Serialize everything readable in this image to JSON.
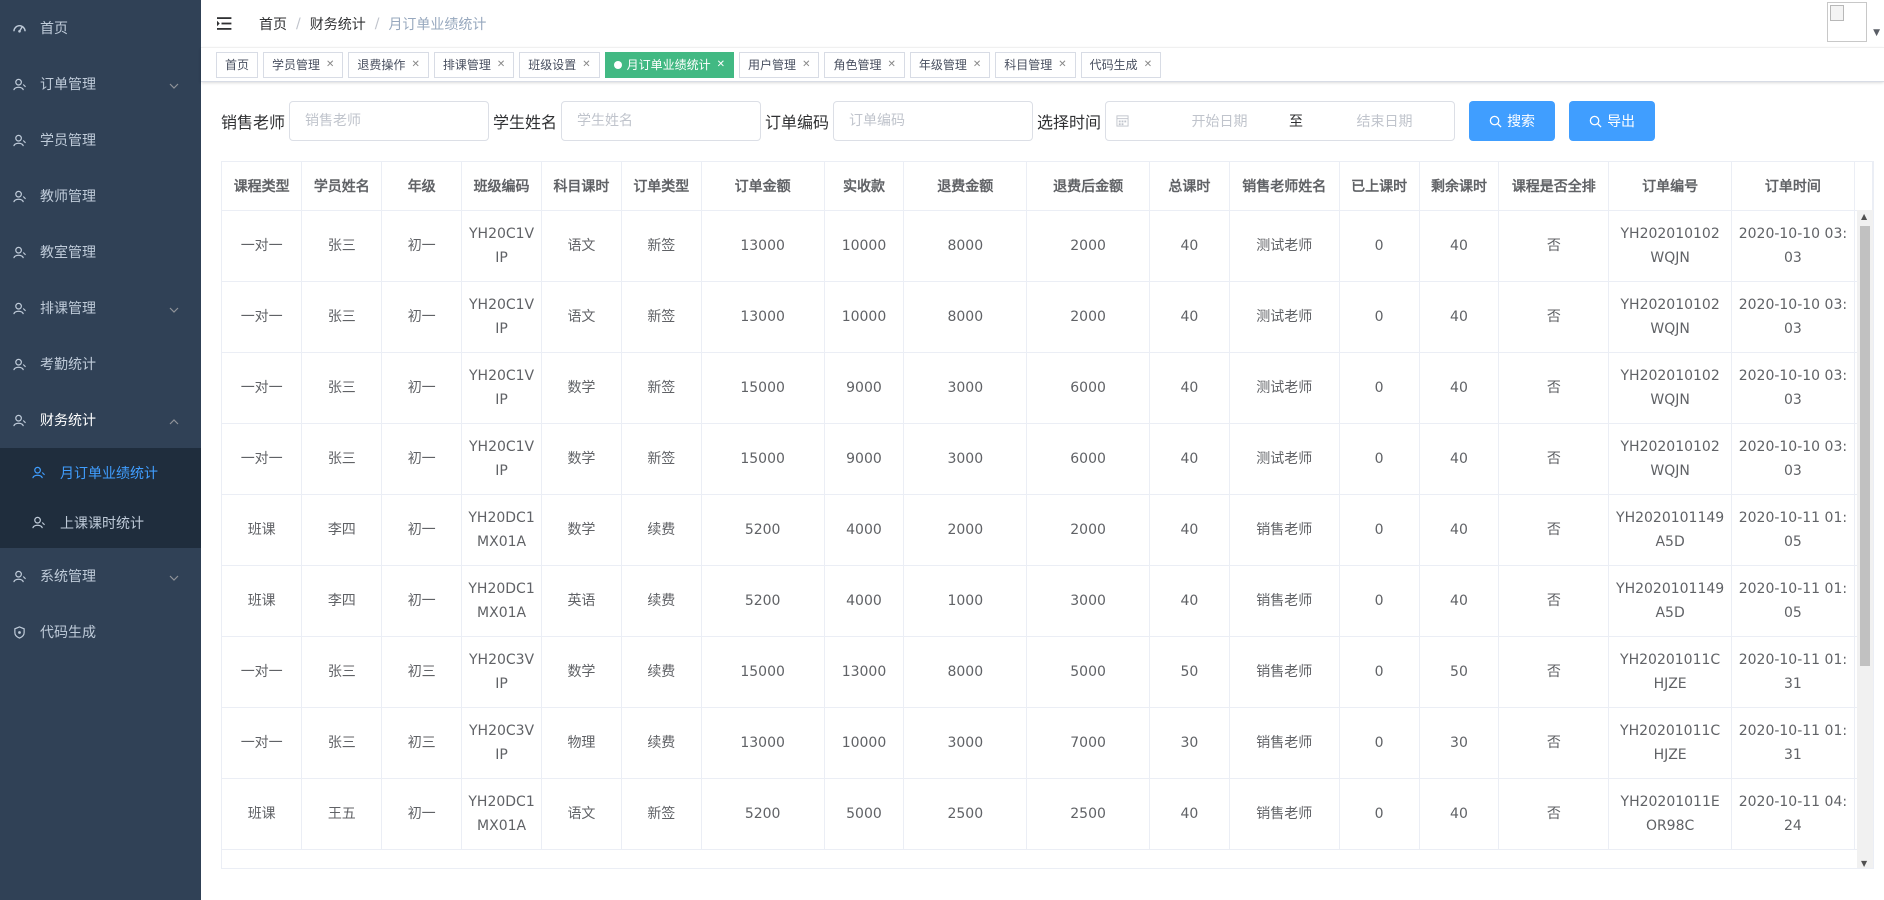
{
  "sidebar": {
    "items": [
      {
        "label": "首页",
        "icon": "dashboard-icon",
        "has_arrow": false
      },
      {
        "label": "订单管理",
        "icon": "user-icon",
        "has_arrow": true
      },
      {
        "label": "学员管理",
        "icon": "user-icon",
        "has_arrow": false
      },
      {
        "label": "教师管理",
        "icon": "user-icon",
        "has_arrow": false
      },
      {
        "label": "教室管理",
        "icon": "user-icon",
        "has_arrow": false
      },
      {
        "label": "排课管理",
        "icon": "user-icon",
        "has_arrow": true
      },
      {
        "label": "考勤统计",
        "icon": "user-icon",
        "has_arrow": false
      },
      {
        "label": "财务统计",
        "icon": "user-icon",
        "has_arrow": true,
        "open": true
      },
      {
        "label": "系统管理",
        "icon": "user-icon",
        "has_arrow": true
      },
      {
        "label": "代码生成",
        "icon": "shield-icon",
        "has_arrow": false
      }
    ],
    "finance_sub": [
      {
        "label": "月订单业绩统计",
        "active": true
      },
      {
        "label": "上课课时统计",
        "active": false
      }
    ]
  },
  "breadcrumb": [
    "首页",
    "财务统计",
    "月订单业绩统计"
  ],
  "tags": [
    {
      "label": "首页",
      "closable": false,
      "active": false
    },
    {
      "label": "学员管理",
      "closable": true,
      "active": false
    },
    {
      "label": "退费操作",
      "closable": true,
      "active": false
    },
    {
      "label": "排课管理",
      "closable": true,
      "active": false
    },
    {
      "label": "班级设置",
      "closable": true,
      "active": false
    },
    {
      "label": "月订单业绩统计",
      "closable": true,
      "active": true
    },
    {
      "label": "用户管理",
      "closable": true,
      "active": false
    },
    {
      "label": "角色管理",
      "closable": true,
      "active": false
    },
    {
      "label": "年级管理",
      "closable": true,
      "active": false
    },
    {
      "label": "科目管理",
      "closable": true,
      "active": false
    },
    {
      "label": "代码生成",
      "closable": true,
      "active": false
    }
  ],
  "search": {
    "sales_label": "销售老师",
    "sales_placeholder": "销售老师",
    "student_label": "学生姓名",
    "student_placeholder": "学生姓名",
    "order_label": "订单编码",
    "order_placeholder": "订单编码",
    "time_label": "选择时间",
    "start_placeholder": "开始日期",
    "range_sep": "至",
    "end_placeholder": "结束日期",
    "search_btn": "搜索",
    "export_btn": "导出"
  },
  "table": {
    "columns": [
      "课程类型",
      "学员姓名",
      "年级",
      "班级编码",
      "科目课时",
      "订单类型",
      "订单金额",
      "实收款",
      "退费金额",
      "退费后金额",
      "总课时",
      "销售老师姓名",
      "已上课时",
      "剩余课时",
      "课程是否全排",
      "订单编号",
      "订单时间"
    ],
    "rows": [
      [
        "一对一",
        "张三",
        "初一",
        "YH20C1VIP",
        "语文",
        "新签",
        "13000",
        "10000",
        "8000",
        "2000",
        "40",
        "测试老师",
        "0",
        "40",
        "否",
        "YH202010102WQJN",
        "2020-10-10 03:03"
      ],
      [
        "一对一",
        "张三",
        "初一",
        "YH20C1VIP",
        "语文",
        "新签",
        "13000",
        "10000",
        "8000",
        "2000",
        "40",
        "测试老师",
        "0",
        "40",
        "否",
        "YH202010102WQJN",
        "2020-10-10 03:03"
      ],
      [
        "一对一",
        "张三",
        "初一",
        "YH20C1VIP",
        "数学",
        "新签",
        "15000",
        "9000",
        "3000",
        "6000",
        "40",
        "测试老师",
        "0",
        "40",
        "否",
        "YH202010102WQJN",
        "2020-10-10 03:03"
      ],
      [
        "一对一",
        "张三",
        "初一",
        "YH20C1VIP",
        "数学",
        "新签",
        "15000",
        "9000",
        "3000",
        "6000",
        "40",
        "测试老师",
        "0",
        "40",
        "否",
        "YH202010102WQJN",
        "2020-10-10 03:03"
      ],
      [
        "班课",
        "李四",
        "初一",
        "YH20DC1MX01A",
        "数学",
        "续费",
        "5200",
        "4000",
        "2000",
        "2000",
        "40",
        "销售老师",
        "0",
        "40",
        "否",
        "YH2020101149A5D",
        "2020-10-11 01:05"
      ],
      [
        "班课",
        "李四",
        "初一",
        "YH20DC1MX01A",
        "英语",
        "续费",
        "5200",
        "4000",
        "1000",
        "3000",
        "40",
        "销售老师",
        "0",
        "40",
        "否",
        "YH2020101149A5D",
        "2020-10-11 01:05"
      ],
      [
        "一对一",
        "张三",
        "初三",
        "YH20C3VIP",
        "数学",
        "续费",
        "15000",
        "13000",
        "8000",
        "5000",
        "50",
        "销售老师",
        "0",
        "50",
        "否",
        "YH20201011CHJZE",
        "2020-10-11 01:31"
      ],
      [
        "一对一",
        "张三",
        "初三",
        "YH20C3VIP",
        "物理",
        "续费",
        "13000",
        "10000",
        "3000",
        "7000",
        "30",
        "销售老师",
        "0",
        "30",
        "否",
        "YH20201011CHJZE",
        "2020-10-11 01:31"
      ],
      [
        "班课",
        "王五",
        "初一",
        "YH20DC1MX01A",
        "语文",
        "新签",
        "5200",
        "5000",
        "2500",
        "2500",
        "40",
        "销售老师",
        "0",
        "40",
        "否",
        "YH20201011EOR98C",
        "2020-10-11 04:24"
      ]
    ]
  }
}
